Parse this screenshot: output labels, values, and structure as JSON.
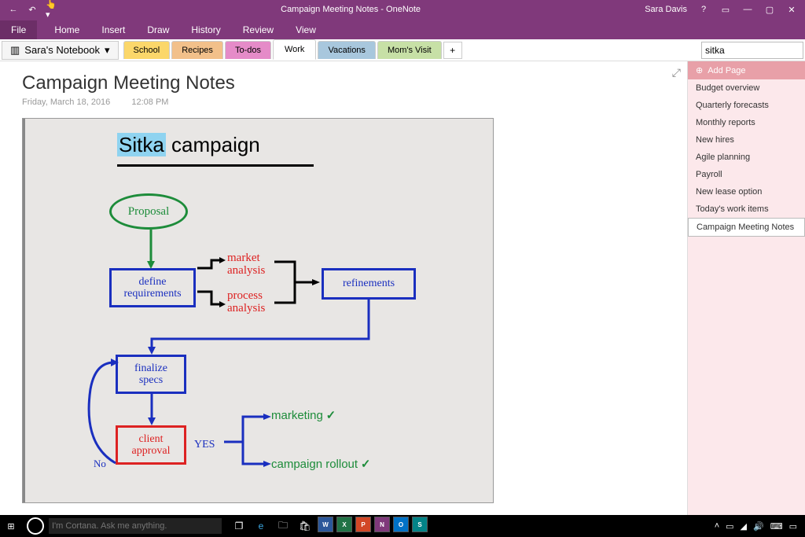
{
  "titlebar": {
    "title": "Campaign Meeting Notes - OneNote",
    "user": "Sara Davis"
  },
  "ribbon": {
    "file": "File",
    "tabs": [
      "Home",
      "Insert",
      "Draw",
      "History",
      "Review",
      "View"
    ]
  },
  "notebook": {
    "name": "Sara's Notebook",
    "sections": [
      {
        "label": "School",
        "cls": "school"
      },
      {
        "label": "Recipes",
        "cls": "recipes"
      },
      {
        "label": "To-dos",
        "cls": "todos"
      },
      {
        "label": "Work",
        "cls": "work"
      },
      {
        "label": "Vacations",
        "cls": "vacations"
      },
      {
        "label": "Mom's Visit",
        "cls": "moms"
      }
    ],
    "add": "+"
  },
  "search": {
    "value": "sitka"
  },
  "page": {
    "title": "Campaign Meeting Notes",
    "date": "Friday, March 18, 2016",
    "time": "12:08 PM"
  },
  "whiteboard": {
    "title_hl": "Sitka",
    "title_rest": " campaign",
    "proposal": "Proposal",
    "define": "define\nrequirements",
    "market": "market\nanalysis",
    "process": "process\nanalysis",
    "refine": "refinements",
    "finalize": "finalize\nspecs",
    "client": "client\napproval",
    "yes": "YES",
    "no": "No",
    "marketing": "marketing",
    "rollout": "campaign rollout"
  },
  "sidebar": {
    "add": "Add Page",
    "pages": [
      "Budget overview",
      "Quarterly forecasts",
      "Monthly reports",
      "New hires",
      "Agile planning",
      "Payroll",
      "New lease option",
      "Today's work items",
      "Campaign Meeting Notes"
    ]
  },
  "taskbar": {
    "search_placeholder": "I'm Cortana. Ask me anything.",
    "apps": [
      "W",
      "X",
      "P",
      "N",
      "O",
      "S"
    ]
  }
}
